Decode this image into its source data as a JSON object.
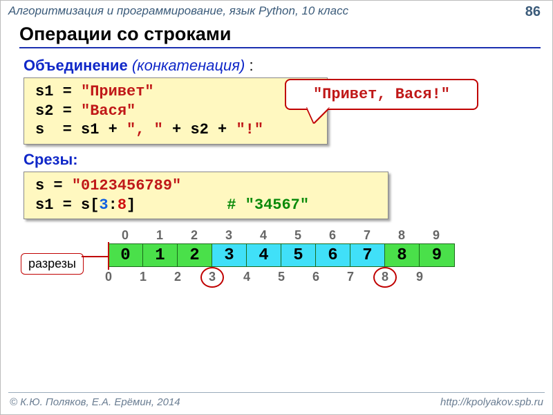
{
  "header": {
    "course": "Алгоритмизация и программирование, язык Python, 10 класс",
    "page": "86"
  },
  "title": "Операции со строками",
  "concat": {
    "label_bold": "Объединение",
    "label_italic": "(конкатенация)",
    "colon": " :",
    "code_line1_a": "s1 = ",
    "code_line1_b": "\"Привет\"",
    "code_line2_a": "s2 = ",
    "code_line2_b": "\"Вася\"",
    "code_line3_a": "s  = s1 + ",
    "code_line3_b": "\", \"",
    "code_line3_c": " + s2 + ",
    "code_line3_d": "\"!\"",
    "callout": "\"Привет, Вася!\""
  },
  "slices": {
    "label": "Срезы:",
    "code_line1_a": "s = ",
    "code_line1_b": "\"0123456789\"",
    "code_line2_a": "s1 = s[",
    "code_line2_b": "3",
    "code_line2_c": ":",
    "code_line2_d": "8",
    "code_line2_e": "]",
    "code_line2_pad": "          ",
    "code_line2_cmt": "# \"34567\""
  },
  "indices_top": [
    "0",
    "1",
    "2",
    "3",
    "4",
    "5",
    "6",
    "7",
    "8",
    "9"
  ],
  "cells": [
    {
      "v": "0",
      "c": "green"
    },
    {
      "v": "1",
      "c": "green"
    },
    {
      "v": "2",
      "c": "green"
    },
    {
      "v": "3",
      "c": "cyan"
    },
    {
      "v": "4",
      "c": "cyan"
    },
    {
      "v": "5",
      "c": "cyan"
    },
    {
      "v": "6",
      "c": "cyan"
    },
    {
      "v": "7",
      "c": "cyan"
    },
    {
      "v": "8",
      "c": "green"
    },
    {
      "v": "9",
      "c": "green"
    }
  ],
  "indices_bot": [
    "0",
    "1",
    "2",
    "3",
    "4",
    "5",
    "6",
    "7",
    "8",
    "9"
  ],
  "cut_label": "разрезы",
  "footer": {
    "left": "© К.Ю. Поляков, Е.А. Ерёмин, 2014",
    "right": "http://kpolyakov.spb.ru"
  }
}
